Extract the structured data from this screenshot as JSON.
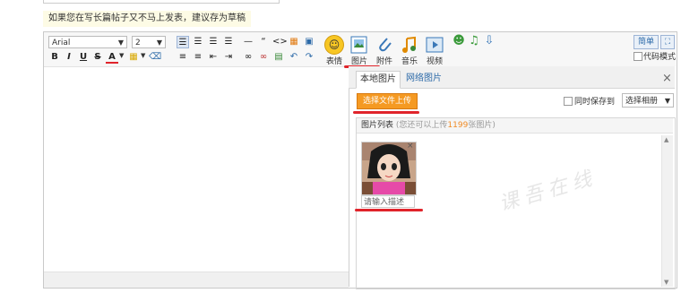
{
  "hint": "如果您在写长篇帖子又不马上发表，建议存为草稿",
  "toolbar": {
    "font_family": "Arial",
    "font_size": "2",
    "simple_label": "简单",
    "code_mode_label": "代码模式",
    "items": {
      "emoji": "表情",
      "image": "图片",
      "attachment": "附件",
      "music": "音乐",
      "video": "视频"
    }
  },
  "image_panel": {
    "tabs": [
      "本地图片",
      "网络图片"
    ],
    "upload_button": "选择文件上传",
    "sync_save_label": "同时保存到",
    "album_select": "选择相册",
    "list_title": "图片列表",
    "list_note_prefix": "(您还可以上传",
    "list_note_count": "1199",
    "list_note_suffix": "张图片)",
    "description_placeholder": "请输入描述",
    "close_icon": "×"
  },
  "watermark": "课吾在线",
  "colors": {
    "accent_red": "#e0242b",
    "upload_orange": "#f59a23",
    "count_orange": "#f08a24",
    "tab_blue": "#2c6aa8"
  }
}
